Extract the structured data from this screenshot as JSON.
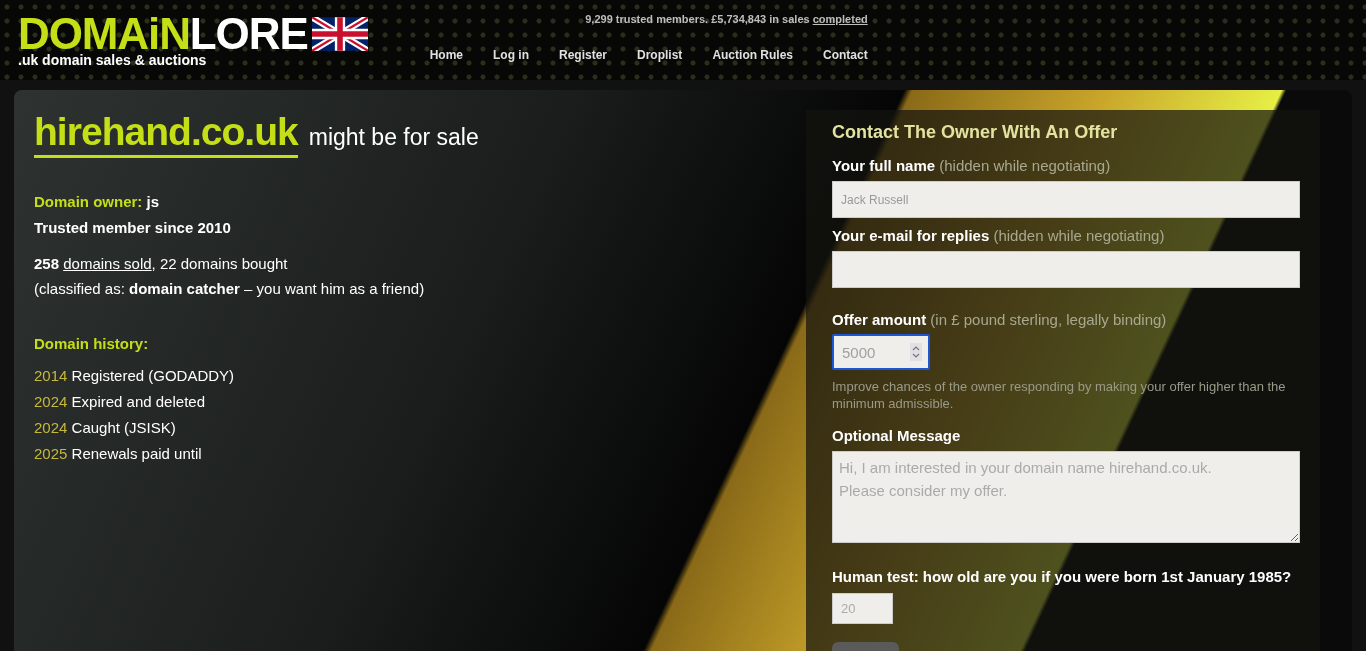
{
  "header": {
    "logo": {
      "part_1": "DOMAiN",
      "part_2": "LORE",
      "tagline": ".uk domain sales & auctions"
    },
    "stats": {
      "text": "9,299 trusted members. £5,734,843 in sales",
      "link": "completed"
    },
    "nav": [
      {
        "label": "Home"
      },
      {
        "label": "Log in"
      },
      {
        "label": "Register"
      },
      {
        "label": "Droplist"
      },
      {
        "label": "Auction Rules"
      },
      {
        "label": "Contact"
      }
    ]
  },
  "domain": {
    "name": "hirehand.co.uk",
    "suffix": "might be for sale"
  },
  "owner": {
    "label": "Domain owner:",
    "value": "js",
    "since": "Trusted member since 2010",
    "sold_count": "258",
    "sold_link": "domains sold",
    "bought": ", 22 domains bought",
    "classification": "(classified as: **domain catcher** – you want him as a friend)"
  },
  "history": {
    "title": "Domain history:",
    "events": [
      {
        "year": "2014",
        "text": "Registered (GODADDY)"
      },
      {
        "year": "2024",
        "text": "Expired and deleted"
      },
      {
        "year": "2024",
        "text": "Caught (JSISK)"
      },
      {
        "year": "2025",
        "text": "Renewals paid until"
      }
    ]
  },
  "form": {
    "title": "Contact The Owner With An Offer",
    "name_field": {
      "label": "Your full name",
      "hint": "(hidden while negotiating)",
      "placeholder": "Jack Russell"
    },
    "email_field": {
      "label": "Your e-mail for replies",
      "hint": "(hidden while negotiating)"
    },
    "offer_field": {
      "label": "Offer amount",
      "hint": "(in £ pound sterling, legally binding)",
      "placeholder": "5000",
      "focused": true
    },
    "offer_note": "Improve chances of the owner responding by making your offer higher than the minimum admissible.",
    "message_field": {
      "label": "Optional Message",
      "placeholder": "Hi, I am interested in your domain name hirehand.co.uk.\nPlease consider my offer."
    },
    "human_test": {
      "label": "Human test: how old are you if you were born 1st January 1985?",
      "placeholder": "20"
    }
  }
}
